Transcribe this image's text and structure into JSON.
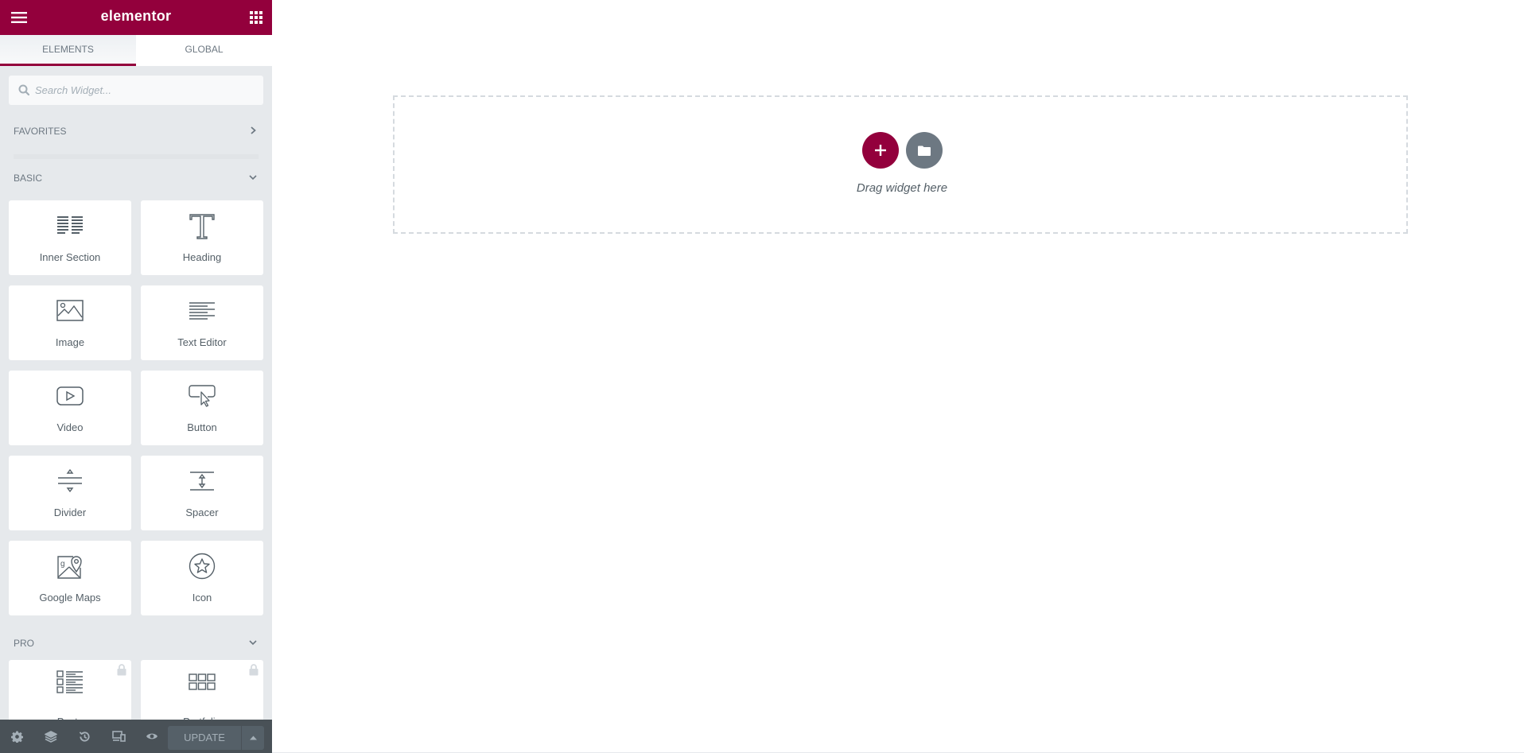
{
  "header": {
    "title": "elementor",
    "menu_icon": "hamburger-icon",
    "apps_icon": "grid-icon"
  },
  "tabs": [
    {
      "label": "ELEMENTS",
      "active": true
    },
    {
      "label": "GLOBAL",
      "active": false
    }
  ],
  "search": {
    "placeholder": "Search Widget...",
    "value": ""
  },
  "categories": {
    "favorites": {
      "title": "FAVORITES",
      "state": "collapsed"
    },
    "basic": {
      "title": "BASIC",
      "state": "expanded",
      "widgets": [
        {
          "label": "Inner Section",
          "icon": "inner-section-icon"
        },
        {
          "label": "Heading",
          "icon": "heading-icon"
        },
        {
          "label": "Image",
          "icon": "image-icon"
        },
        {
          "label": "Text Editor",
          "icon": "text-editor-icon"
        },
        {
          "label": "Video",
          "icon": "video-icon"
        },
        {
          "label": "Button",
          "icon": "button-icon"
        },
        {
          "label": "Divider",
          "icon": "divider-icon"
        },
        {
          "label": "Spacer",
          "icon": "spacer-icon"
        },
        {
          "label": "Google Maps",
          "icon": "google-maps-icon"
        },
        {
          "label": "Icon",
          "icon": "star-icon"
        }
      ]
    },
    "pro": {
      "title": "PRO",
      "state": "expanded",
      "widgets": [
        {
          "label": "Posts",
          "icon": "posts-icon",
          "locked": true
        },
        {
          "label": "Portfolio",
          "icon": "portfolio-icon",
          "locked": true
        }
      ]
    }
  },
  "footer": {
    "buttons": [
      "settings",
      "navigator",
      "history",
      "responsive-mode",
      "preview"
    ],
    "update_label": "UPDATE"
  },
  "canvas": {
    "drag_hint": "Drag widget here"
  },
  "colors": {
    "brand": "#93003c",
    "panel_bg": "#e6e9ec",
    "footer_bg": "#495157",
    "template_btn": "#6d7882"
  }
}
